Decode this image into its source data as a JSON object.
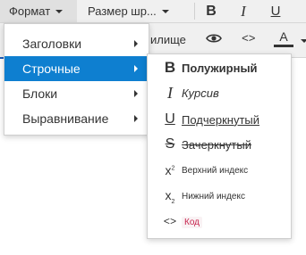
{
  "toolbar": {
    "format_label": "Формат",
    "font_size_label": "Размер шр...",
    "bold_glyph": "B",
    "italic_glyph": "I",
    "underline_glyph": "U",
    "row2_partial_label": "илище",
    "source_code_glyph": "<>",
    "font_color_glyph": "A"
  },
  "format_menu": {
    "items": [
      {
        "label": "Заголовки",
        "has_submenu": true
      },
      {
        "label": "Строчные",
        "has_submenu": true,
        "active": true
      },
      {
        "label": "Блоки",
        "has_submenu": true
      },
      {
        "label": "Выравнивание",
        "has_submenu": true
      }
    ]
  },
  "inline_submenu": {
    "items": [
      {
        "icon": "bold-icon",
        "glyph": "B",
        "label": "Полужирный"
      },
      {
        "icon": "italic-icon",
        "glyph": "I",
        "label": "Курсив"
      },
      {
        "icon": "underline-icon",
        "glyph": "U",
        "label": "Подчеркнутый"
      },
      {
        "icon": "strikethrough-icon",
        "glyph": "S",
        "label": "Зачеркнутый"
      },
      {
        "icon": "superscript-icon",
        "glyph": "x",
        "glyph_mark": "2",
        "label": "Верхний индекс"
      },
      {
        "icon": "subscript-icon",
        "glyph": "x",
        "glyph_mark": "2",
        "label": "Нижний индекс"
      },
      {
        "icon": "code-icon",
        "glyph": "<>",
        "label": "Код"
      }
    ]
  },
  "colors": {
    "active_item_bg": "#0e7fd0",
    "toolbar_bg": "#f0f0f0",
    "code_text": "#c7254e",
    "code_bg": "#f9f2f4"
  }
}
